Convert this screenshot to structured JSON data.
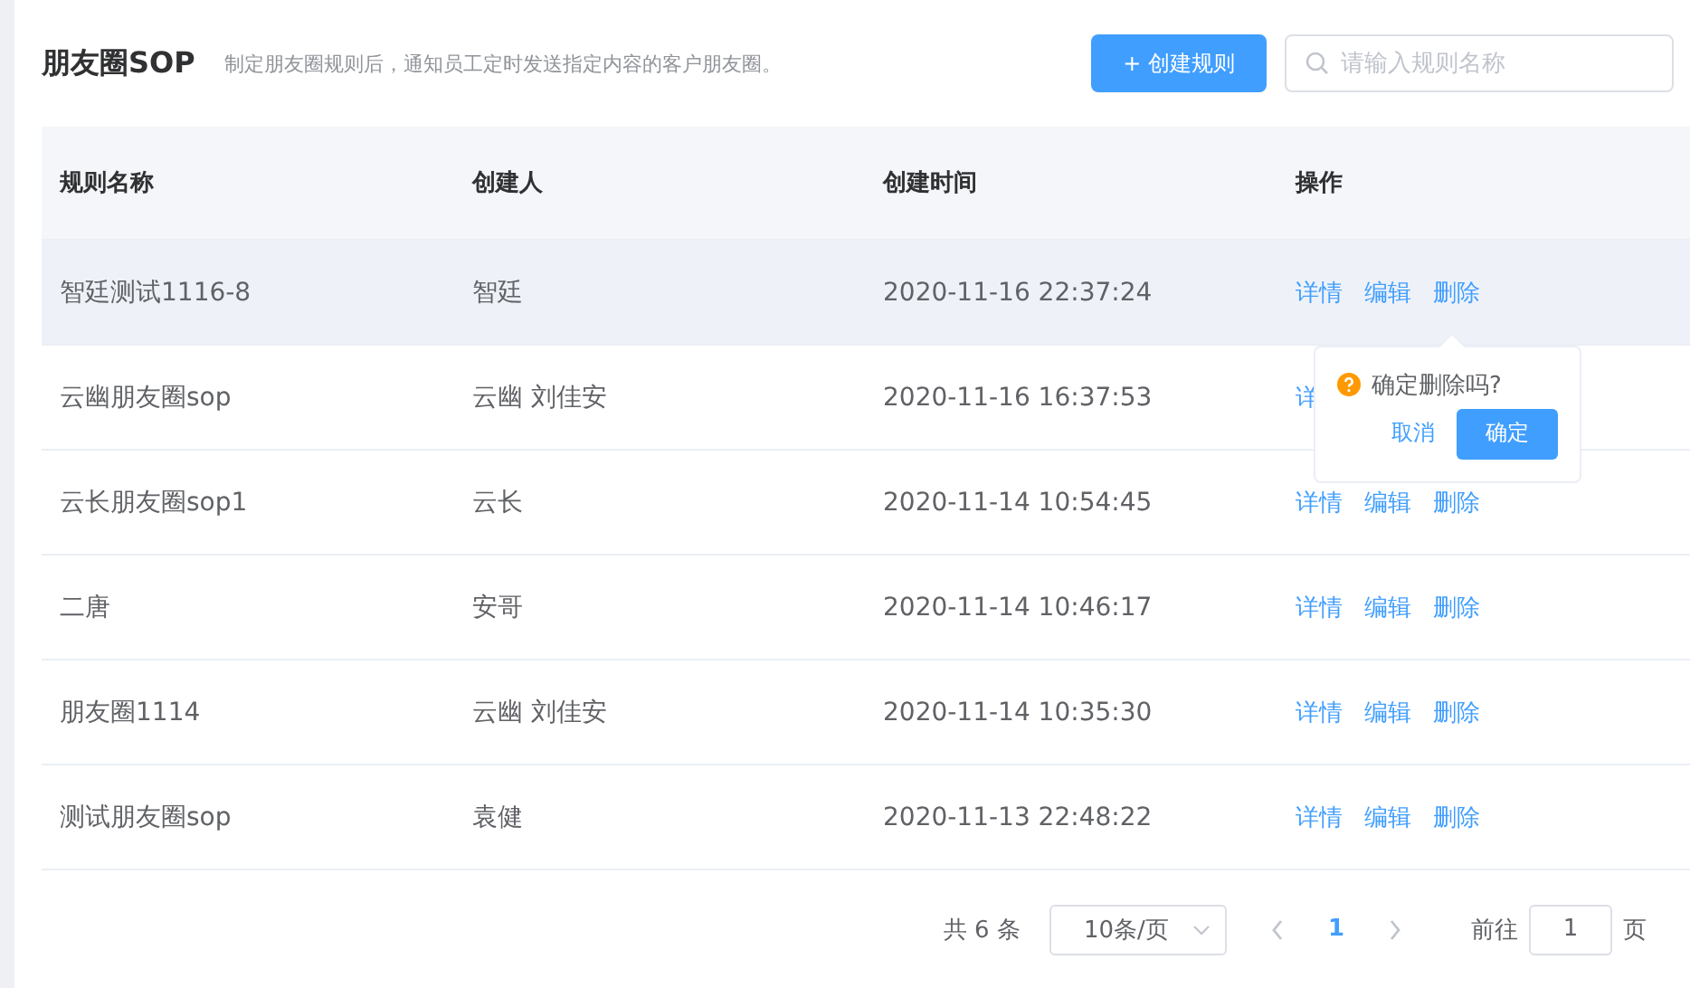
{
  "header": {
    "title": "朋友圈SOP",
    "description": "制定朋友圈规则后，通知员工定时发送指定内容的客户朋友圈。",
    "create_button": "+ 创建规则",
    "search": {
      "placeholder": "请输入规则名称"
    }
  },
  "table": {
    "columns": [
      "规则名称",
      "创建人",
      "创建时间",
      "操作"
    ],
    "rows": [
      {
        "name": "智廷测试1116-8",
        "creator": "智廷",
        "time": "2020-11-16 22:37:24",
        "actions": [
          "详情",
          "编辑",
          "删除"
        ],
        "hovered": true
      },
      {
        "name": "云幽朋友圈sop",
        "creator": "云幽 刘佳安",
        "time": "2020-11-16 16:37:53",
        "actions": [
          "详"
        ],
        "hovered": false
      },
      {
        "name": "云长朋友圈sop1",
        "creator": "云长",
        "time": "2020-11-14 10:54:45",
        "actions": [
          "详情",
          "编辑",
          "删除"
        ],
        "hovered": false
      },
      {
        "name": "二唐",
        "creator": "安哥",
        "time": "2020-11-14 10:46:17",
        "actions": [
          "详情",
          "编辑",
          "删除"
        ],
        "hovered": false
      },
      {
        "name": "朋友圈1114",
        "creator": "云幽 刘佳安",
        "time": "2020-11-14 10:35:30",
        "actions": [
          "详情",
          "编辑",
          "删除"
        ],
        "hovered": false
      },
      {
        "name": "测试朋友圈sop",
        "creator": "袁健",
        "time": "2020-11-13 22:48:22",
        "actions": [
          "详情",
          "编辑",
          "删除"
        ],
        "hovered": false
      }
    ]
  },
  "popconfirm": {
    "message": "确定删除吗?",
    "cancel": "取消",
    "confirm": "确定"
  },
  "pagination": {
    "total": "共 6 条",
    "page_size": "10条/页",
    "pages": [
      {
        "label": "1",
        "selected": true
      }
    ],
    "goto_label": "前往",
    "goto_value": "1",
    "goto_suffix": "页"
  }
}
